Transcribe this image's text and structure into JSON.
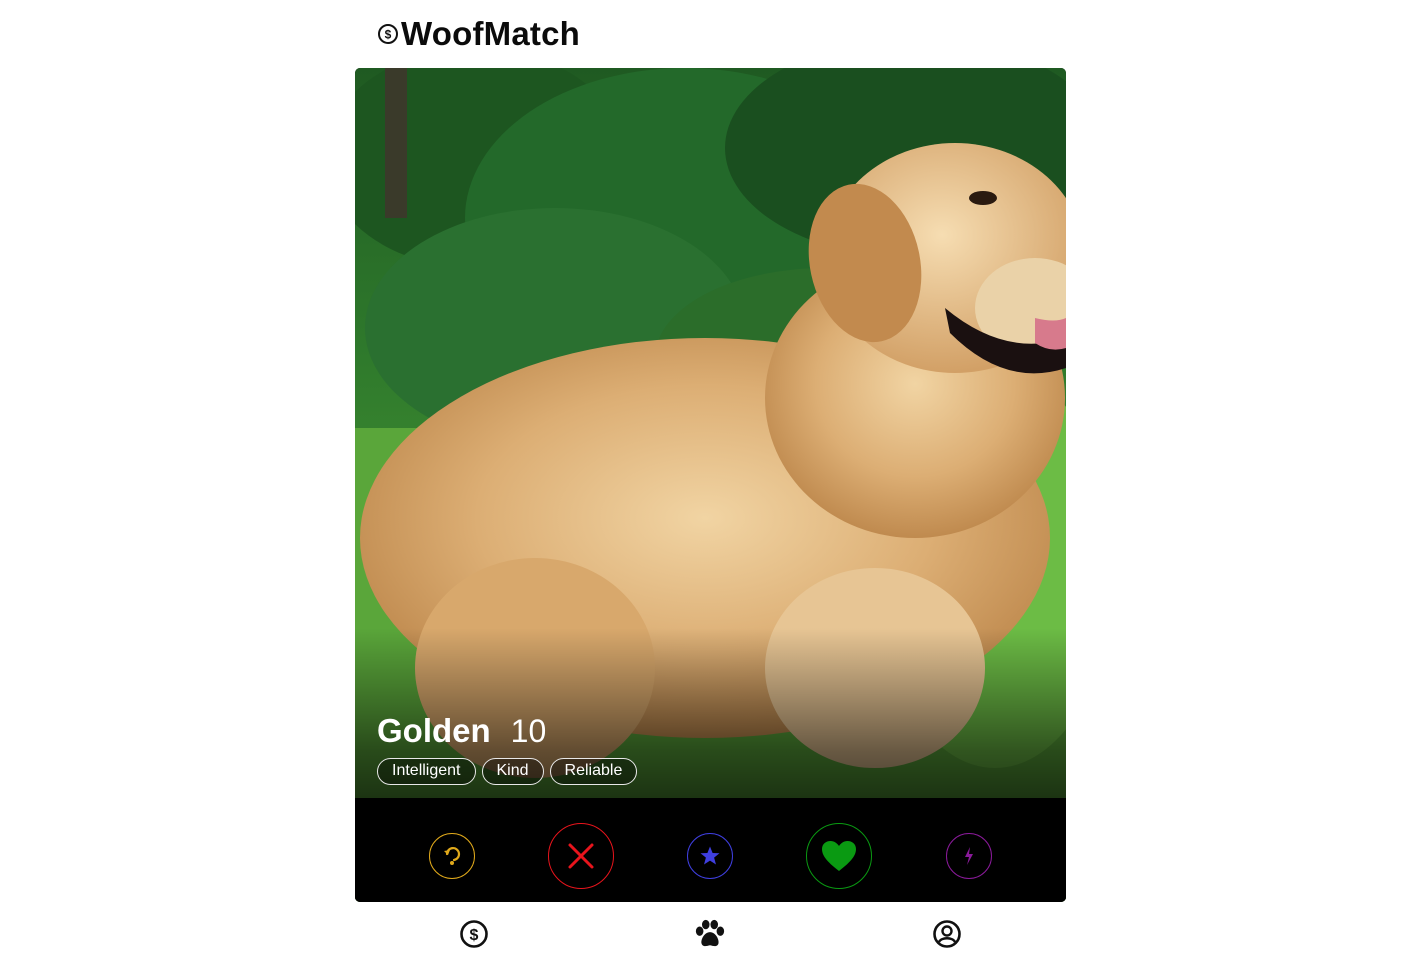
{
  "app": {
    "brand": "WoofMatch",
    "logo_icon": "dollar-circle-icon"
  },
  "profile": {
    "name": "Golden",
    "age": "10",
    "tags": [
      "Intelligent",
      "Kind",
      "Reliable"
    ],
    "photo_subject": "golden-retriever-dog-photo"
  },
  "actions": [
    {
      "id": "rewind",
      "icon": "rewind-icon",
      "color": "#e0a91b"
    },
    {
      "id": "nope",
      "icon": "close-icon",
      "color": "#e8141c"
    },
    {
      "id": "super-like",
      "icon": "star-icon",
      "color": "#3f3fe0"
    },
    {
      "id": "like",
      "icon": "heart-icon",
      "color": "#0a9a12"
    },
    {
      "id": "boost",
      "icon": "lightning-icon",
      "color": "#8a1a9a"
    }
  ],
  "nav": [
    {
      "id": "premium",
      "icon": "dollar-circle-icon"
    },
    {
      "id": "swipe",
      "icon": "paw-icon"
    },
    {
      "id": "profile",
      "icon": "user-circle-icon"
    }
  ]
}
